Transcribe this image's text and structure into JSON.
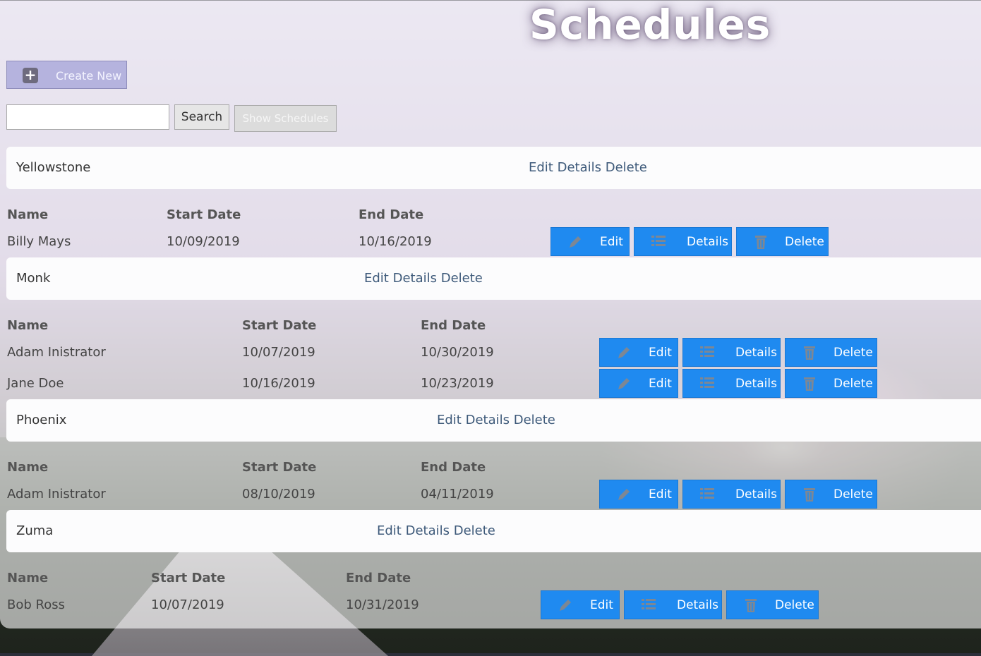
{
  "page": {
    "title": "Schedules"
  },
  "toolbar": {
    "create_label": "Create New",
    "search_value": "",
    "search_label": "Search",
    "show_label": "Show Schedules"
  },
  "headers": {
    "name": "Name",
    "start": "Start Date",
    "end": "End Date"
  },
  "site_links": "Edit Details Delete",
  "buttons": {
    "edit": "Edit",
    "details": "Details",
    "delete": "Delete"
  },
  "sites": [
    {
      "name": "Yellowstone",
      "rows": [
        {
          "name": "Billy Mays",
          "start": "10/09/2019",
          "end": "10/16/2019"
        }
      ]
    },
    {
      "name": "Monk",
      "rows": [
        {
          "name": "Adam Inistrator",
          "start": "10/07/2019",
          "end": "10/30/2019"
        },
        {
          "name": "Jane Doe",
          "start": "10/16/2019",
          "end": "10/23/2019"
        }
      ]
    },
    {
      "name": "Phoenix",
      "rows": [
        {
          "name": "Adam Inistrator",
          "start": "08/10/2019",
          "end": "04/11/2019"
        }
      ]
    },
    {
      "name": "Zuma",
      "rows": [
        {
          "name": "Bob Ross",
          "start": "10/07/2019",
          "end": "10/31/2019"
        }
      ]
    }
  ],
  "colors": {
    "button": "#1f8af0",
    "link": "#3e5a7a",
    "create_button": "#b5b3de"
  },
  "icons": {
    "create": "plus-icon",
    "edit": "pencil-icon",
    "details": "list-icon",
    "delete": "trash-icon"
  }
}
